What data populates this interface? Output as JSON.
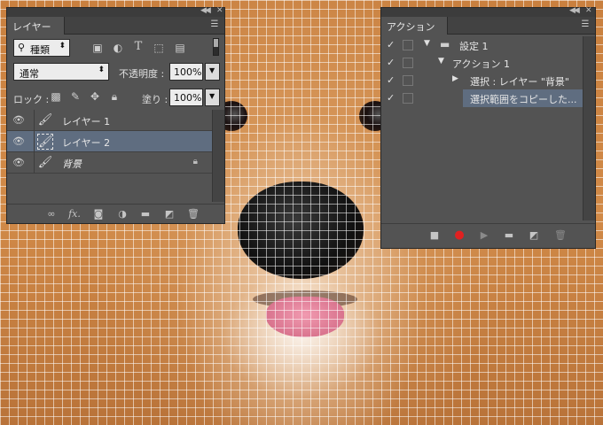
{
  "canvas": {
    "colors": {
      "fur": "#d18a48",
      "grid": "#ffffff",
      "nose": "#111111",
      "tongue": "#e58aa0"
    }
  },
  "layers_panel": {
    "tab_label": "レイヤー",
    "filter_label": "種類",
    "filter_icons": [
      "image-filter-icon",
      "adjustment-filter-icon",
      "type-filter-icon",
      "shape-filter-icon",
      "smart-object-filter-icon"
    ],
    "blend_mode": "通常",
    "opacity_label": "不透明度 :",
    "opacity_value": "100%",
    "lock_label": "ロック :",
    "fill_label": "塗り :",
    "fill_value": "100%",
    "layers": [
      {
        "name": "レイヤー 1",
        "selected": false,
        "locked": false
      },
      {
        "name": "レイヤー 2",
        "selected": true,
        "locked": false
      },
      {
        "name": "背景",
        "selected": false,
        "locked": true
      }
    ],
    "footer_icons": [
      "link-icon",
      "fx-icon",
      "mask-icon",
      "adjustment-icon",
      "group-icon",
      "new-layer-icon",
      "trash-icon"
    ],
    "fx_label": "fx."
  },
  "actions_panel": {
    "tab_label": "アクション",
    "items": [
      {
        "name": "設定 1",
        "level": 0,
        "type": "set",
        "checked": true,
        "selected": false
      },
      {
        "name": "アクション 1",
        "level": 1,
        "type": "action",
        "checked": true,
        "selected": false
      },
      {
        "name": "選択 : レイヤー \"背景\"",
        "level": 2,
        "type": "step",
        "checked": true,
        "selected": false
      },
      {
        "name": "選択範囲をコピーした...",
        "level": 3,
        "type": "step",
        "checked": true,
        "selected": true
      }
    ],
    "footer_icons": [
      "stop-icon",
      "record-icon",
      "play-icon",
      "new-set-icon",
      "new-action-icon",
      "trash-icon"
    ],
    "record_color": "#e02020"
  }
}
